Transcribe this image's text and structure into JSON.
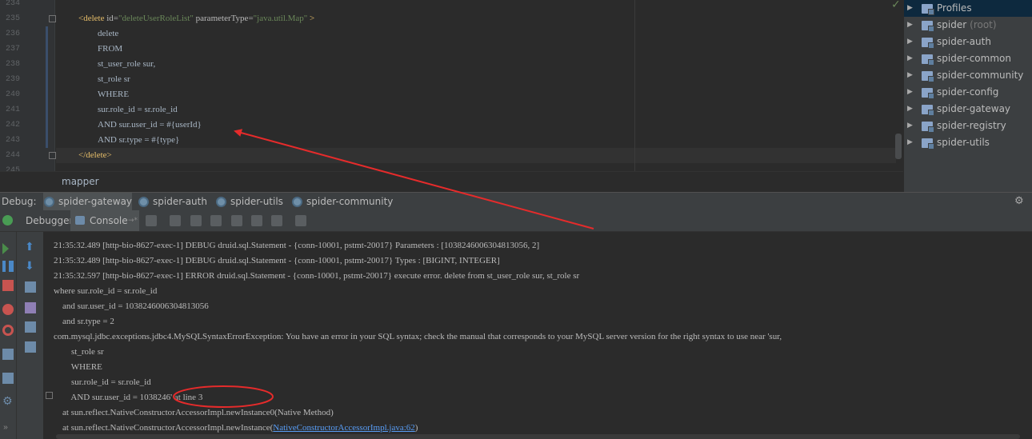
{
  "editor": {
    "line_numbers": [
      "234",
      "235",
      "236",
      "237",
      "238",
      "239",
      "240",
      "241",
      "242",
      "243",
      "244",
      "245"
    ],
    "lines": [
      {
        "parts": [
          {
            "t": "",
            "c": ""
          }
        ]
      },
      {
        "parts": [
          {
            "t": "<delete",
            "c": "tag"
          },
          {
            "t": " id=",
            "c": "attr"
          },
          {
            "t": "\"deleteUserRoleList\"",
            "c": "str"
          },
          {
            "t": " parameterType=",
            "c": "attr"
          },
          {
            "t": "\"java.util.Map\"",
            "c": "str"
          },
          {
            "t": " >",
            "c": "tag"
          }
        ]
      },
      {
        "parts": [
          {
            "t": "delete",
            "c": ""
          }
        ]
      },
      {
        "parts": [
          {
            "t": "FROM",
            "c": ""
          }
        ]
      },
      {
        "parts": [
          {
            "t": "st_user_role sur,",
            "c": ""
          }
        ]
      },
      {
        "parts": [
          {
            "t": "st_role sr",
            "c": ""
          }
        ]
      },
      {
        "parts": [
          {
            "t": "WHERE",
            "c": ""
          }
        ]
      },
      {
        "parts": [
          {
            "t": "sur.role_id = sr.role_id",
            "c": ""
          }
        ]
      },
      {
        "parts": [
          {
            "t": "AND sur.user_id = #{userId}",
            "c": ""
          }
        ]
      },
      {
        "parts": [
          {
            "t": "AND sr.type = #{type}",
            "c": ""
          }
        ]
      },
      {
        "parts": [
          {
            "t": "</delete>",
            "c": "tag"
          }
        ]
      }
    ],
    "breadcrumb": "mapper"
  },
  "project_tree": {
    "items": [
      {
        "label": "Profiles",
        "muted": ""
      },
      {
        "label": "spider",
        "muted": "(root)"
      },
      {
        "label": "spider-auth",
        "muted": ""
      },
      {
        "label": "spider-common",
        "muted": ""
      },
      {
        "label": "spider-community",
        "muted": ""
      },
      {
        "label": "spider-config",
        "muted": ""
      },
      {
        "label": "spider-gateway",
        "muted": ""
      },
      {
        "label": "spider-registry",
        "muted": ""
      },
      {
        "label": "spider-utils",
        "muted": ""
      }
    ]
  },
  "debug": {
    "label": "Debug:",
    "tabs": [
      "spider-gateway",
      "spider-auth",
      "spider-utils",
      "spider-community"
    ],
    "toolbar": {
      "debugger": "Debugger",
      "console": "Console"
    }
  },
  "console": {
    "lines": [
      "21:35:32.489 [http-bio-8627-exec-1] DEBUG druid.sql.Statement - {conn-10001, pstmt-20017} Parameters : [1038246006304813056, 2]",
      "21:35:32.489 [http-bio-8627-exec-1] DEBUG druid.sql.Statement - {conn-10001, pstmt-20017} Types : [BIGINT, INTEGER]",
      "21:35:32.597 [http-bio-8627-exec-1] ERROR druid.sql.Statement - {conn-10001, pstmt-20017} execute error. delete from st_user_role sur, st_role sr",
      "where sur.role_id = sr.role_id",
      "    and sur.user_id = 1038246006304813056",
      "    and sr.type = 2",
      "com.mysql.jdbc.exceptions.jdbc4.MySQLSyntaxErrorException: You have an error in your SQL syntax; check the manual that corresponds to your MySQL server version for the right syntax to use near 'sur,",
      "        st_role sr",
      "        WHERE",
      "        sur.role_id = sr.role_id",
      "        AND sur.user_id = 1038246' at line 3",
      "    at sun.reflect.NativeConstructorAccessorImpl.newInstance0(Native Method)"
    ],
    "last_line_prefix": "    at sun.reflect.NativeConstructorAccessorImpl.newInstance(",
    "last_line_link": "NativeConstructorAccessorImpl.java:62",
    "last_line_suffix": ")"
  },
  "colors": {
    "annotation": "#e52b2b",
    "editor_bg": "#2b2b2b",
    "panel_bg": "#3c3f41"
  }
}
